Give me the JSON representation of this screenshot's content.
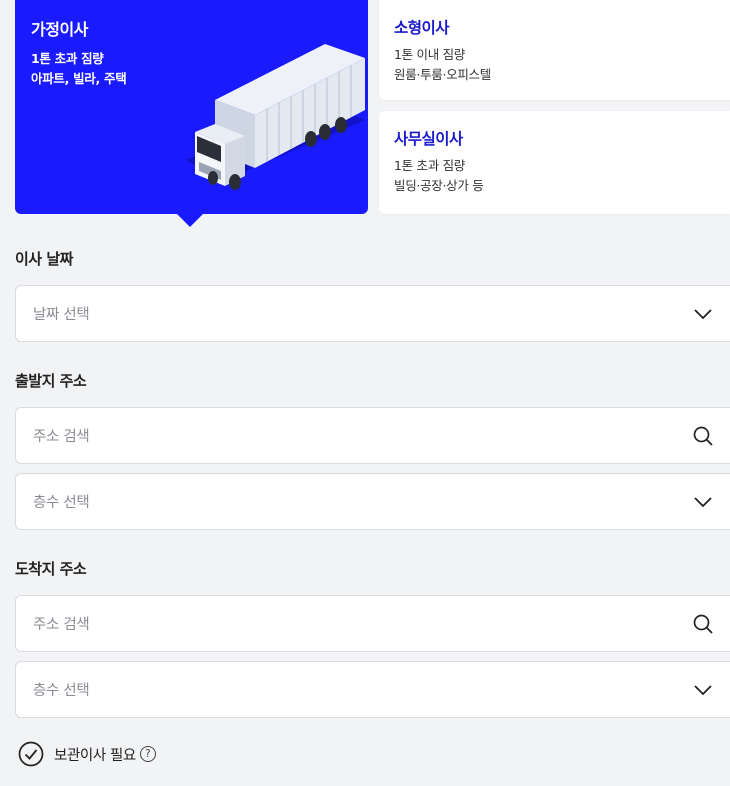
{
  "move_types": [
    {
      "title": "가정이사",
      "desc1": "1톤 초과 짐량",
      "desc2": "아파트, 빌라, 주택",
      "selected": true
    },
    {
      "title": "소형이사",
      "desc1": "1톤 이내 짐량",
      "desc2": "원룸·투룸·오피스텔",
      "selected": false
    },
    {
      "title": "사무실이사",
      "desc1": "1톤 초과 짐량",
      "desc2": "빌딩·공장·상가 등",
      "selected": false
    }
  ],
  "date_section": {
    "label": "이사 날짜",
    "placeholder": "날짜 선택",
    "icon": "chevron-down-icon"
  },
  "origin_section": {
    "label": "출발지 주소",
    "address_placeholder": "주소 검색",
    "address_icon": "search-icon",
    "floor_placeholder": "층수 선택",
    "floor_icon": "chevron-down-icon"
  },
  "destination_section": {
    "label": "도착지 주소",
    "address_placeholder": "주소 검색",
    "address_icon": "search-icon",
    "floor_placeholder": "층수 선택",
    "floor_icon": "chevron-down-icon"
  },
  "storage": {
    "label": "보관이사 필요",
    "help_symbol": "?",
    "checked": true
  },
  "colors": {
    "accent": "#1a1aff",
    "accent_text": "#1a1acc",
    "background": "#f2f3f5",
    "placeholder": "#8a8d93"
  }
}
